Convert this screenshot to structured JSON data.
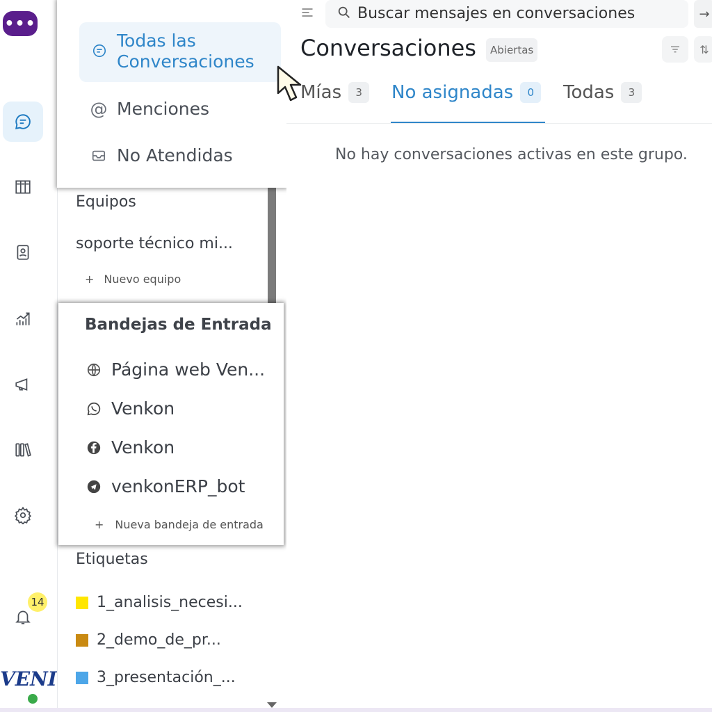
{
  "rail": {
    "notifications_count": "14",
    "brand_text": "VENI",
    "logo_glyph": "•••",
    "accent_color": "#5a1e8c"
  },
  "nav": {
    "all_conversations": "Todas las Conversaciones",
    "mentions": "Menciones",
    "unattended": "No Atendidas"
  },
  "teams": {
    "title": "Equipos",
    "items": [
      "soporte técnico mi..."
    ],
    "new_label": "Nuevo equipo"
  },
  "inboxes": {
    "title": "Bandejas de Entrada",
    "items": [
      {
        "label": "Página web Ven...",
        "icon": "globe-icon"
      },
      {
        "label": "Venkon",
        "icon": "whatsapp-icon"
      },
      {
        "label": "Venkon",
        "icon": "facebook-icon"
      },
      {
        "label": "venkonERP_bot",
        "icon": "telegram-icon"
      }
    ],
    "new_label": "Nueva bandeja de entrada"
  },
  "labels": {
    "title": "Etiquetas",
    "items": [
      {
        "label": "1_analisis_necesi...",
        "color": "#ffe600"
      },
      {
        "label": "2_demo_de_pr...",
        "color": "#c98a12"
      },
      {
        "label": "3_presentación_...",
        "color": "#4da6e8"
      }
    ]
  },
  "header": {
    "search_placeholder": "Buscar mensajes en conversaciones",
    "title": "Conversaciones",
    "status": "Abiertas"
  },
  "tabs": [
    {
      "label": "Mías",
      "count": "3"
    },
    {
      "label": "No asignadas",
      "count": "0"
    },
    {
      "label": "Todas",
      "count": "3"
    }
  ],
  "empty_message": "No hay conversaciones activas en este grupo.",
  "colors": {
    "primary_blue": "#2f86c9"
  }
}
